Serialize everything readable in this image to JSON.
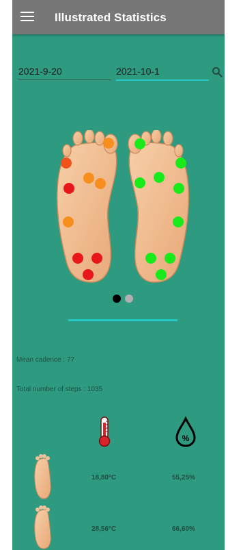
{
  "header": {
    "title": "Illustrated Statistics",
    "menu_icon": "menu-icon"
  },
  "date_range": {
    "start": "2021-9-20",
    "end": "2021-10-1",
    "search_icon": "search-icon"
  },
  "sensor_colors": {
    "high": "#e8181a",
    "mid_high": "#f0521c",
    "medium": "#f78e1e",
    "low": "#19ea19"
  },
  "pager": {
    "pages": 2,
    "active": 1
  },
  "stats": {
    "mean_cadence": "Mean cadence : 77",
    "total_steps": "Total number of steps : 1035"
  },
  "measures": {
    "icons": [
      "thermometer-icon",
      "humidity-percent-icon"
    ],
    "rows": [
      {
        "temperature": "18,80°C",
        "humidity": "55,25%"
      },
      {
        "temperature": "28,56°C",
        "humidity": "66,60%"
      }
    ]
  },
  "theme": {
    "background": "#2e9a80",
    "app_bar": "#777777",
    "accent": "#26c8c8"
  }
}
